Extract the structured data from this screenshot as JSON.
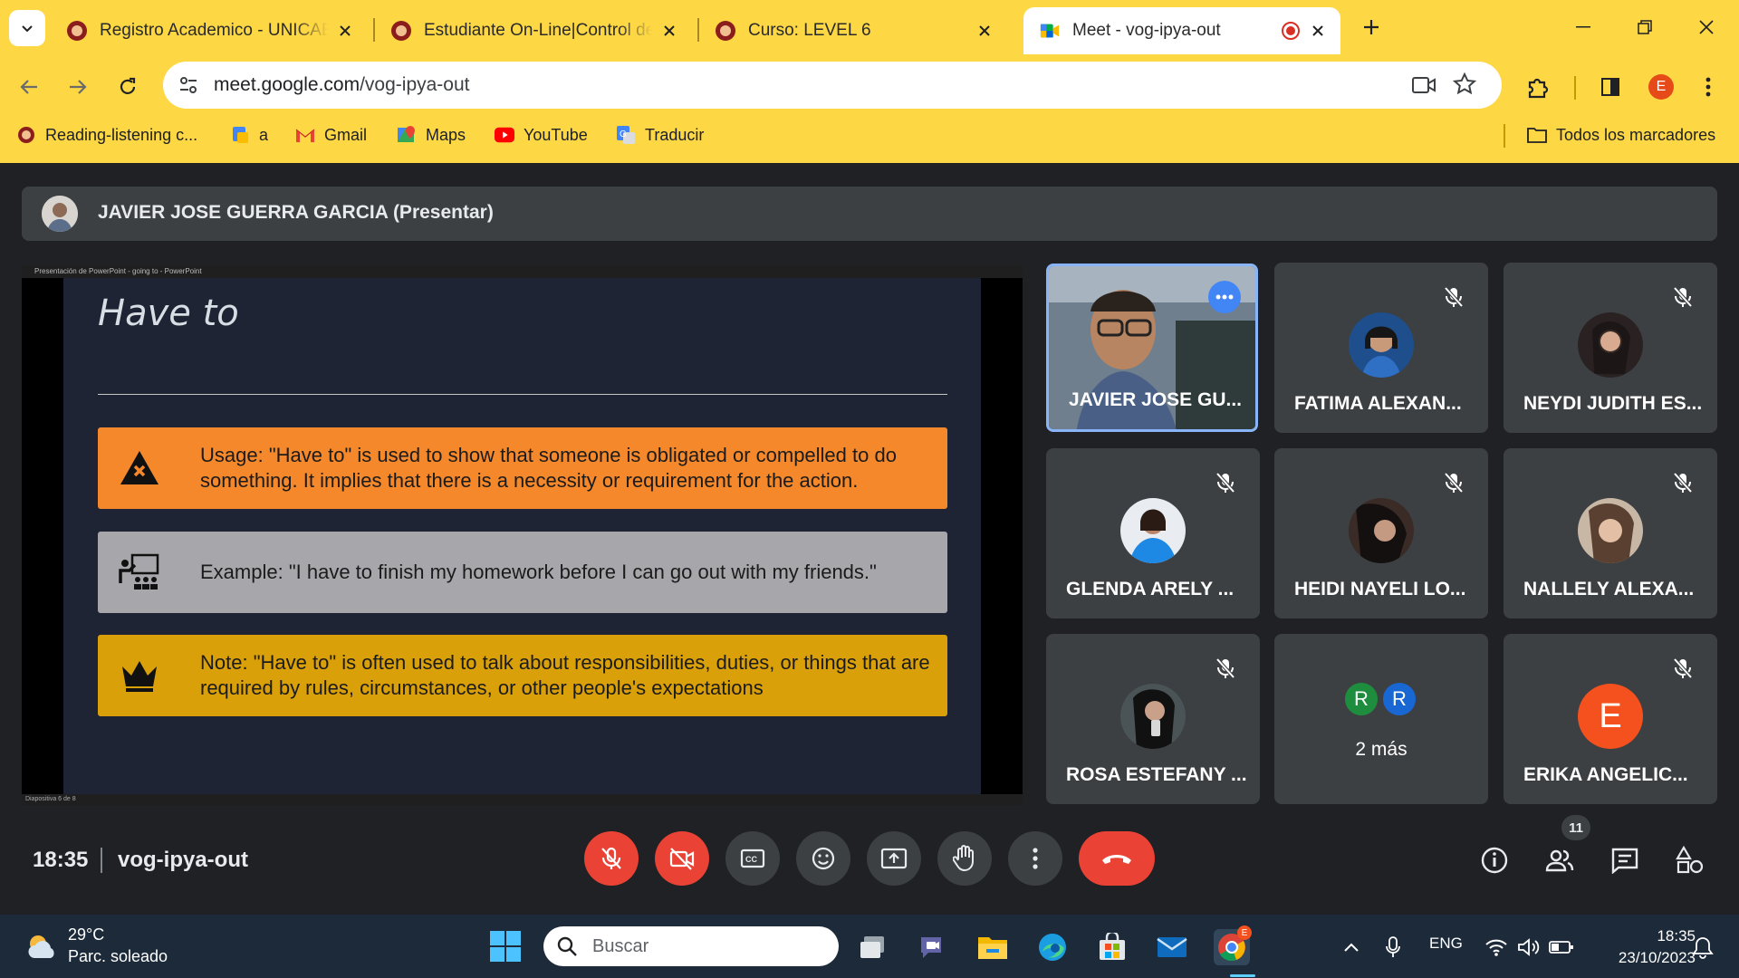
{
  "browser": {
    "tabs": [
      {
        "title": "Registro Academico - UNICAES"
      },
      {
        "title": "Estudiante On-Line|Control de"
      },
      {
        "title": "Curso: LEVEL 6"
      },
      {
        "title": "Meet - vog-ipya-out"
      }
    ],
    "url": {
      "host": "meet.google.com",
      "path": "/vog-ipya-out"
    },
    "profile_initial": "E",
    "bookmarks": [
      {
        "label": "Reading-listening c..."
      },
      {
        "label": "a"
      },
      {
        "label": "Gmail"
      },
      {
        "label": "Maps"
      },
      {
        "label": "YouTube"
      },
      {
        "label": "Traducir"
      }
    ],
    "all_bookmarks": "Todos los marcadores"
  },
  "meet": {
    "presenter_label": "JAVIER JOSE GUERRA GARCIA (Presentar)",
    "slide": {
      "window_title": "Presentación de PowerPoint  -  going to  -  PowerPoint",
      "heading": "Have to",
      "boxes": [
        {
          "icon": "warning-icon",
          "color": "#f5882a",
          "text": "Usage: \"Have to\" is used to show that someone is obligated or compelled to do something. It implies that there is a necessity or requirement for the action."
        },
        {
          "icon": "teacher-icon",
          "color": "#a7a7ab",
          "text": "Example: \"I have to finish my homework before I can go out with my friends.\""
        },
        {
          "icon": "crown-icon",
          "color": "#daa00a",
          "text": "Note: \"Have to\" is often used to talk about responsibilities, duties, or things that are required by rules, circumstances, or other people's expectations"
        }
      ],
      "status": "Diapositiva 6 de 8"
    },
    "participants": [
      {
        "name": "JAVIER JOSE GU...",
        "active": true
      },
      {
        "name": "FATIMA ALEXAN...",
        "muted": true
      },
      {
        "name": "NEYDI JUDITH ES...",
        "muted": true
      },
      {
        "name": "GLENDA ARELY ...",
        "muted": true
      },
      {
        "name": "HEIDI NAYELI LO...",
        "muted": true
      },
      {
        "name": "NALLELY ALEXA...",
        "muted": true
      },
      {
        "name": "ROSA ESTEFANY ...",
        "muted": true
      },
      {
        "name": "2 más",
        "initials": [
          "R",
          "R"
        ]
      },
      {
        "name": "ERIKA ANGELIC...",
        "initial": "E",
        "muted": true
      }
    ],
    "time": "18:35",
    "meeting_code": "vog-ipya-out",
    "participant_count": "11"
  },
  "taskbar": {
    "weather_temp": "29°C",
    "weather_desc": "Parc. soleado",
    "search_placeholder": "Buscar",
    "language": "ENG",
    "time": "18:35",
    "date": "23/10/2023"
  },
  "colors": {
    "chrome": "#fed744",
    "meet_bg": "#202124",
    "tile": "#3c4043",
    "red": "#ea4335",
    "accent": "#8ab4f8"
  }
}
